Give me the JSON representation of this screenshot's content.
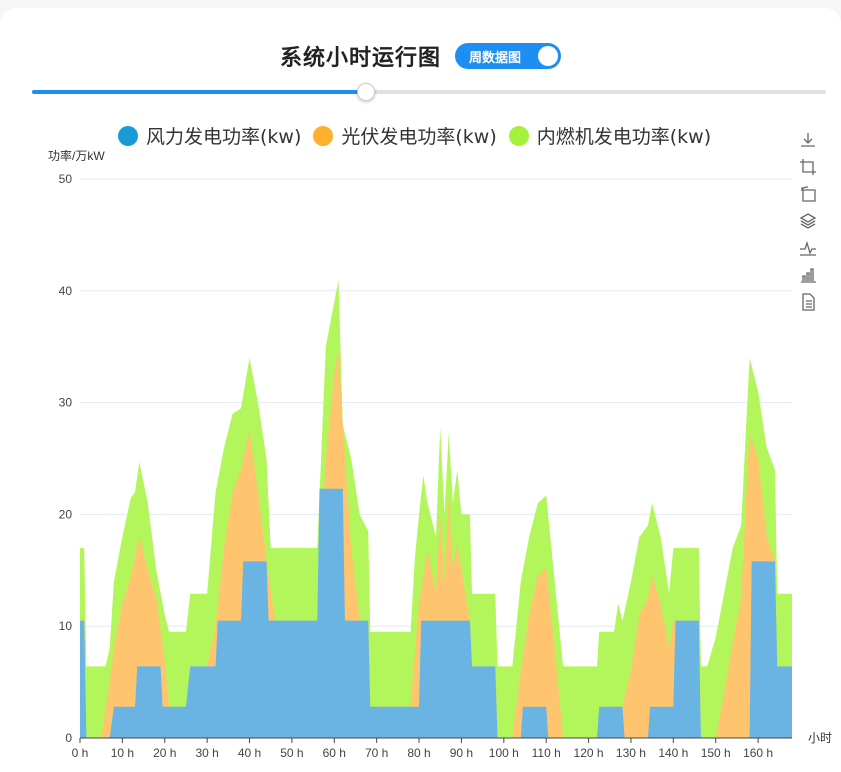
{
  "title": "系统小时运行图",
  "toggle": {
    "label": "周数据图",
    "on": true
  },
  "slider": {
    "value": 0.42
  },
  "colors": {
    "accent": "#1f8ef1",
    "wind": "#6ab4e3",
    "solar": "#ffc46e",
    "diesel": "#b3f65c",
    "legend_wind": "#1a9bd7",
    "legend_solar": "#ffb02e",
    "legend_diesel": "#a5f03b"
  },
  "toolbox": [
    {
      "name": "download-icon"
    },
    {
      "name": "crop-icon"
    },
    {
      "name": "restore-icon"
    },
    {
      "name": "stack-icon"
    },
    {
      "name": "line-chart-icon"
    },
    {
      "name": "bar-chart-icon"
    },
    {
      "name": "data-view-icon"
    }
  ],
  "chart_data": {
    "type": "area",
    "stacked": true,
    "title": "",
    "ylabel": "功率/万kW",
    "xlabel": "小时",
    "xlim": [
      0,
      168
    ],
    "ylim": [
      0,
      50
    ],
    "yticks": [
      0,
      10,
      20,
      30,
      40,
      50
    ],
    "xticks": [
      0,
      10,
      20,
      30,
      40,
      50,
      60,
      70,
      80,
      90,
      100,
      110,
      120,
      130,
      140,
      150,
      160
    ],
    "tick_suffix": " h",
    "grid": true,
    "legend_position": "top",
    "series": [
      {
        "name": "风力发电功率(kw)",
        "points": [
          [
            0,
            10.5
          ],
          [
            1,
            10.5
          ],
          [
            1.5,
            0
          ],
          [
            7,
            0
          ],
          [
            8,
            2.8
          ],
          [
            13,
            2.8
          ],
          [
            13.5,
            6.4
          ],
          [
            19,
            6.4
          ],
          [
            19.5,
            2.8
          ],
          [
            25,
            2.8
          ],
          [
            26,
            6.4
          ],
          [
            32,
            6.4
          ],
          [
            32.5,
            10.5
          ],
          [
            38,
            10.5
          ],
          [
            38.5,
            15.8
          ],
          [
            44,
            15.8
          ],
          [
            44.5,
            10.5
          ],
          [
            56,
            10.5
          ],
          [
            56.5,
            22.3
          ],
          [
            62,
            22.3
          ],
          [
            62.5,
            10.5
          ],
          [
            68,
            10.5
          ],
          [
            68.5,
            2.8
          ],
          [
            80,
            2.8
          ],
          [
            80.5,
            10.5
          ],
          [
            92,
            10.5
          ],
          [
            92.5,
            6.4
          ],
          [
            98,
            6.4
          ],
          [
            98.5,
            0
          ],
          [
            104,
            0
          ],
          [
            104.5,
            2.8
          ],
          [
            110,
            2.8
          ],
          [
            110.5,
            0
          ],
          [
            122,
            0
          ],
          [
            122.5,
            2.8
          ],
          [
            128,
            2.8
          ],
          [
            128.5,
            0
          ],
          [
            134,
            0
          ],
          [
            134.5,
            2.8
          ],
          [
            140,
            2.8
          ],
          [
            140.5,
            10.5
          ],
          [
            146,
            10.5
          ],
          [
            146.5,
            0
          ],
          [
            158,
            0
          ],
          [
            158.5,
            15.8
          ],
          [
            164,
            15.8
          ],
          [
            164.5,
            6.4
          ],
          [
            168,
            6.4
          ]
        ]
      },
      {
        "name": "光伏发电功率(kw)",
        "points": [
          [
            0,
            10.5
          ],
          [
            1,
            10.5
          ],
          [
            1.5,
            0
          ],
          [
            5,
            0
          ],
          [
            7,
            5
          ],
          [
            8,
            8
          ],
          [
            10,
            12
          ],
          [
            12,
            14.5
          ],
          [
            14,
            18
          ],
          [
            16,
            15
          ],
          [
            18,
            12.5
          ],
          [
            20,
            7
          ],
          [
            21,
            2.8
          ],
          [
            25,
            2.8
          ],
          [
            26,
            6.4
          ],
          [
            30,
            6.4
          ],
          [
            32,
            10
          ],
          [
            34,
            17
          ],
          [
            36,
            22
          ],
          [
            38,
            24
          ],
          [
            40,
            27.5
          ],
          [
            42,
            22
          ],
          [
            44,
            16
          ],
          [
            46,
            10.5
          ],
          [
            56,
            10.5
          ],
          [
            58,
            25
          ],
          [
            60,
            32.5
          ],
          [
            61,
            34.7
          ],
          [
            62,
            28
          ],
          [
            64,
            17
          ],
          [
            66,
            10.5
          ],
          [
            68,
            10.5
          ],
          [
            68.5,
            2.8
          ],
          [
            78,
            2.8
          ],
          [
            80,
            12
          ],
          [
            82,
            16.8
          ],
          [
            84,
            13
          ],
          [
            85,
            20
          ],
          [
            86,
            14
          ],
          [
            87,
            21.5
          ],
          [
            88,
            15
          ],
          [
            89,
            17.5
          ],
          [
            90,
            15
          ],
          [
            92,
            10.5
          ],
          [
            92.5,
            6.4
          ],
          [
            98,
            6.4
          ],
          [
            98.5,
            0
          ],
          [
            102,
            0
          ],
          [
            104,
            6
          ],
          [
            106,
            11
          ],
          [
            108,
            14.5
          ],
          [
            110,
            15.2
          ],
          [
            112,
            8
          ],
          [
            114,
            0
          ],
          [
            122,
            0
          ],
          [
            124,
            2.8
          ],
          [
            128,
            2.8
          ],
          [
            130,
            6
          ],
          [
            132,
            11
          ],
          [
            134,
            12.5
          ],
          [
            135,
            14.5
          ],
          [
            137,
            12
          ],
          [
            139,
            8
          ],
          [
            140,
            10.5
          ],
          [
            146,
            10.5
          ],
          [
            146.5,
            0
          ],
          [
            150,
            0
          ],
          [
            152,
            4
          ],
          [
            154,
            8.5
          ],
          [
            156,
            12.5
          ],
          [
            158,
            27.2
          ],
          [
            160,
            25
          ],
          [
            162,
            18
          ],
          [
            164,
            15.8
          ],
          [
            164.5,
            6.4
          ],
          [
            168,
            6.4
          ]
        ]
      },
      {
        "name": "内燃机发电功率(kw)",
        "points": [
          [
            0,
            17
          ],
          [
            1,
            17
          ],
          [
            1.5,
            6.4
          ],
          [
            6,
            6.4
          ],
          [
            7,
            8
          ],
          [
            8,
            14
          ],
          [
            10,
            18
          ],
          [
            12,
            21.5
          ],
          [
            13,
            22
          ],
          [
            14,
            24.7
          ],
          [
            16,
            21
          ],
          [
            18,
            15
          ],
          [
            20,
            11
          ],
          [
            21,
            9.5
          ],
          [
            25,
            9.5
          ],
          [
            26,
            12.9
          ],
          [
            30,
            12.9
          ],
          [
            32,
            22
          ],
          [
            34,
            26
          ],
          [
            36,
            29
          ],
          [
            38,
            29.5
          ],
          [
            40,
            34
          ],
          [
            42,
            30
          ],
          [
            44,
            25
          ],
          [
            45,
            17
          ],
          [
            56,
            17
          ],
          [
            58,
            35
          ],
          [
            60,
            39
          ],
          [
            61,
            41
          ],
          [
            62,
            28
          ],
          [
            64,
            25
          ],
          [
            66,
            20
          ],
          [
            68,
            18.5
          ],
          [
            68.5,
            9.5
          ],
          [
            78,
            9.5
          ],
          [
            79,
            16
          ],
          [
            80,
            20
          ],
          [
            81,
            23.5
          ],
          [
            82,
            21
          ],
          [
            84,
            18
          ],
          [
            85,
            27.8
          ],
          [
            86,
            20
          ],
          [
            87,
            27.3
          ],
          [
            88,
            21
          ],
          [
            89,
            24
          ],
          [
            90,
            20
          ],
          [
            92,
            20
          ],
          [
            92.5,
            12.9
          ],
          [
            98,
            12.9
          ],
          [
            98.5,
            6.4
          ],
          [
            102,
            6.4
          ],
          [
            104,
            14
          ],
          [
            106,
            18
          ],
          [
            108,
            21
          ],
          [
            110,
            21.7
          ],
          [
            112,
            14
          ],
          [
            114,
            6.4
          ],
          [
            122,
            6.4
          ],
          [
            122.5,
            9.5
          ],
          [
            126,
            9.5
          ],
          [
            127,
            12
          ],
          [
            128,
            10.5
          ],
          [
            130,
            14
          ],
          [
            132,
            18
          ],
          [
            134,
            19
          ],
          [
            135,
            21
          ],
          [
            137,
            18
          ],
          [
            139,
            13
          ],
          [
            140,
            17
          ],
          [
            146,
            17
          ],
          [
            146.5,
            6.4
          ],
          [
            148,
            6.4
          ],
          [
            150,
            9
          ],
          [
            152,
            13
          ],
          [
            154,
            17
          ],
          [
            156,
            19
          ],
          [
            158,
            34
          ],
          [
            160,
            31
          ],
          [
            162,
            26
          ],
          [
            164,
            24
          ],
          [
            164.5,
            12.9
          ],
          [
            168,
            12.9
          ]
        ]
      }
    ]
  }
}
